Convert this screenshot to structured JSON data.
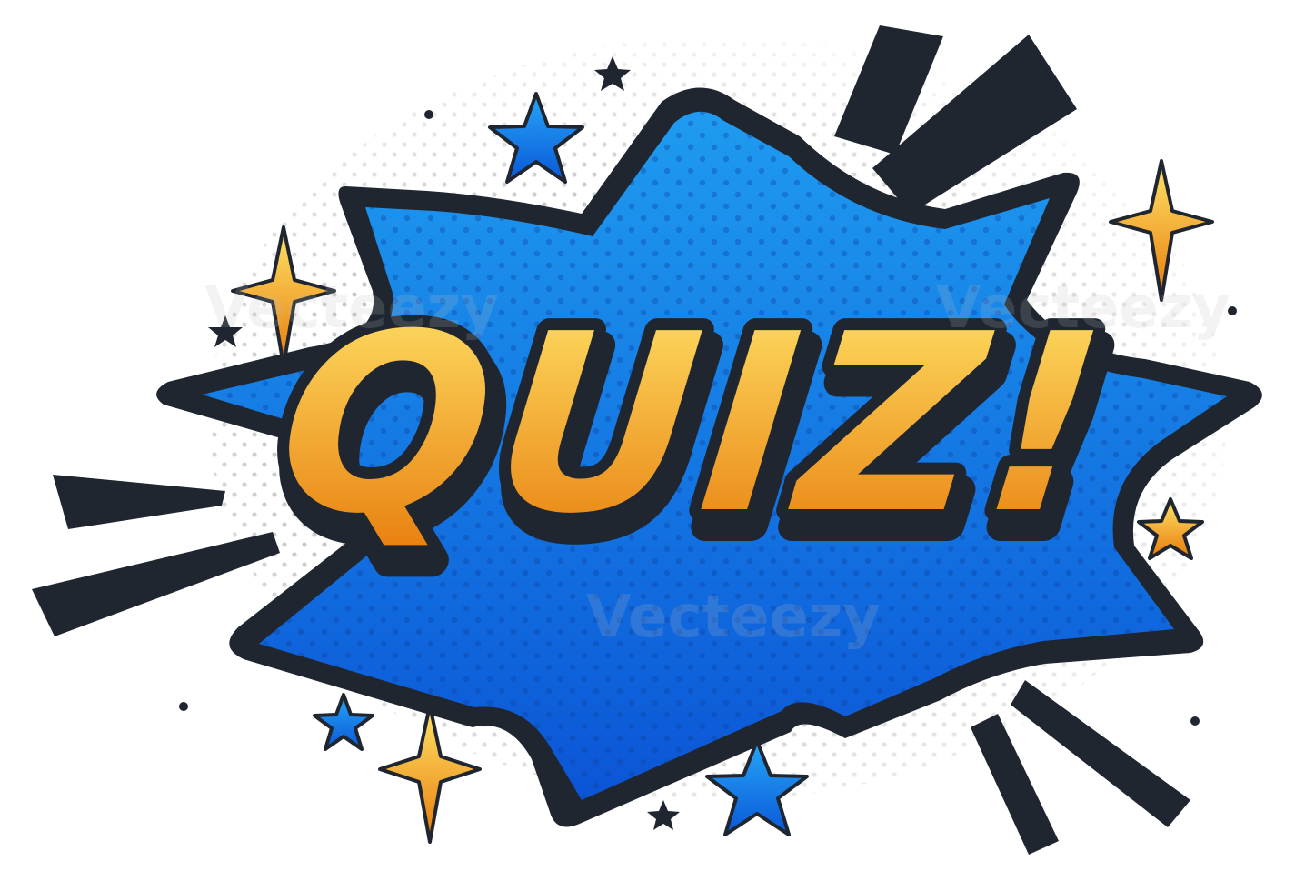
{
  "graphic": {
    "headline": "QUIZ!",
    "watermark_text": "Vecteezy",
    "colors": {
      "outline": "#1f2630",
      "burst_blue_light": "#1e9bf0",
      "burst_blue_dark": "#0b55d6",
      "text_gold_light": "#ffe468",
      "text_gold_dark": "#e77a0a",
      "halftone_dot": "#c7c7c7",
      "star_blue_light": "#27a6f7",
      "star_blue_dark": "#0a58d8"
    },
    "icons": [
      "speech-burst",
      "blue-star",
      "gold-sparkle",
      "dark-star",
      "action-line",
      "halftone-dot"
    ]
  }
}
